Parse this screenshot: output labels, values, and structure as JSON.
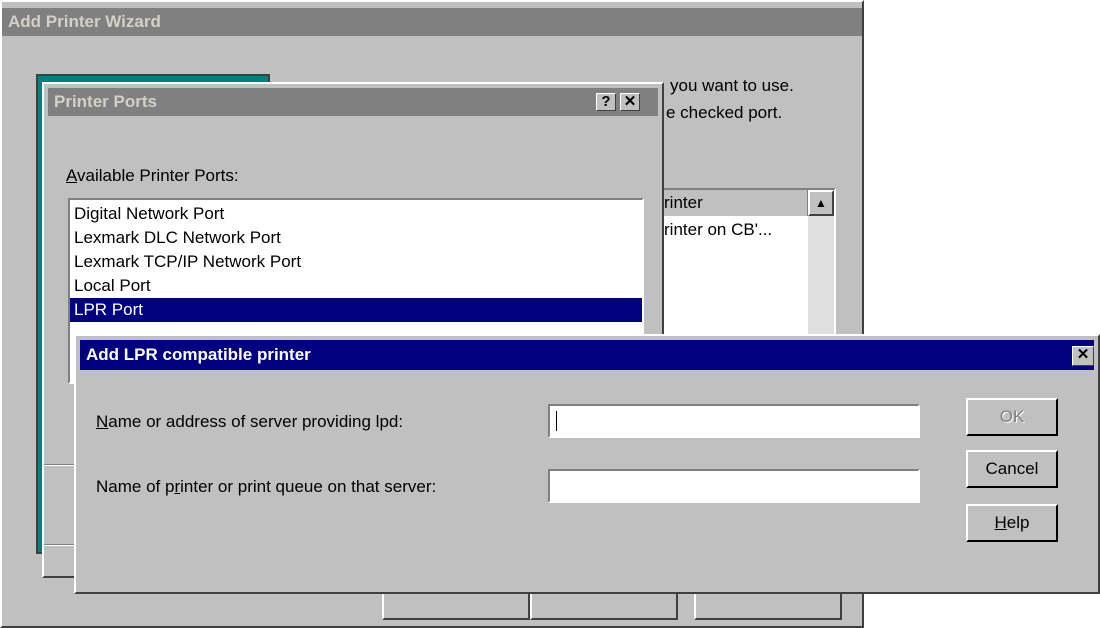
{
  "wizard": {
    "title": "Add Printer Wizard",
    "instruction_line1": "Click the check box next to the port(s) you want to use.",
    "instruction_line2": "Documents will print to the first free checked port.",
    "visible_line1": "you want to use.",
    "visible_line2": "e checked port.",
    "list_header": "rinter",
    "list_row1": "rinter on CB'..."
  },
  "ports_dialog": {
    "title": "Printer Ports",
    "help_glyph": "?",
    "close_glyph": "✕",
    "label_prefix": "",
    "label_accel": "A",
    "label_rest": "vailable Printer Ports:",
    "ports": [
      "Digital Network Port",
      "Lexmark DLC Network Port",
      "Lexmark TCP/IP Network Port",
      "Local Port",
      "LPR Port"
    ],
    "selected_index": 4
  },
  "lpr_dialog": {
    "title": "Add LPR compatible printer",
    "close_glyph": "✕",
    "server_label_accel": "N",
    "server_label_rest": "ame or address of server providing lpd:",
    "queue_label_pre": "Name of p",
    "queue_label_accel": "r",
    "queue_label_rest": "inter or print queue on that server:",
    "server_value": "",
    "queue_value": "",
    "ok_label": "OK",
    "cancel_label": "Cancel",
    "help_accel": "H",
    "help_rest": "elp"
  }
}
